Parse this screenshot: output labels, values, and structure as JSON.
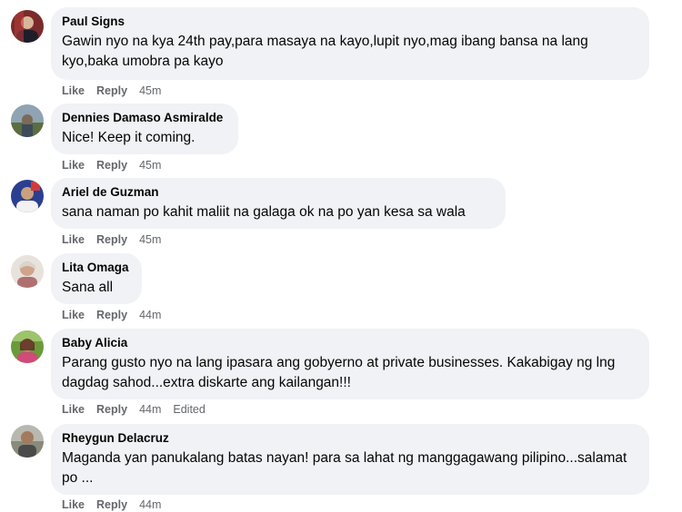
{
  "comments": [
    {
      "author": "Paul Signs",
      "text": "Gawin nyo na kya 24th pay,para masaya na kayo,lupit nyo,mag ibang bansa na lang kyo,baka umobra pa kayo",
      "like": "Like",
      "reply": "Reply",
      "time": "45m",
      "edited": ""
    },
    {
      "author": "Dennies Damaso Asmiralde",
      "text": "Nice! Keep it coming.",
      "like": "Like",
      "reply": "Reply",
      "time": "45m",
      "edited": ""
    },
    {
      "author": "Ariel de Guzman",
      "text": "sana naman po kahit maliit na galaga ok na po yan kesa sa wala",
      "like": "Like",
      "reply": "Reply",
      "time": "45m",
      "edited": ""
    },
    {
      "author": "Lita Omaga",
      "text": "Sana all",
      "like": "Like",
      "reply": "Reply",
      "time": "44m",
      "edited": ""
    },
    {
      "author": "Baby Alicia",
      "text": "Parang gusto nyo na lang ipasara ang gobyerno at private businesses. Kakabigay ng lng dagdag sahod...extra diskarte ang kailangan!!!",
      "like": "Like",
      "reply": "Reply",
      "time": "44m",
      "edited": "Edited"
    },
    {
      "author": "Rheygun Delacruz",
      "text": "Maganda yan panukalang batas nayan! para sa lahat ng manggagawang pilipino...salamat po ...",
      "like": "Like",
      "reply": "Reply",
      "time": "44m",
      "edited": ""
    }
  ]
}
